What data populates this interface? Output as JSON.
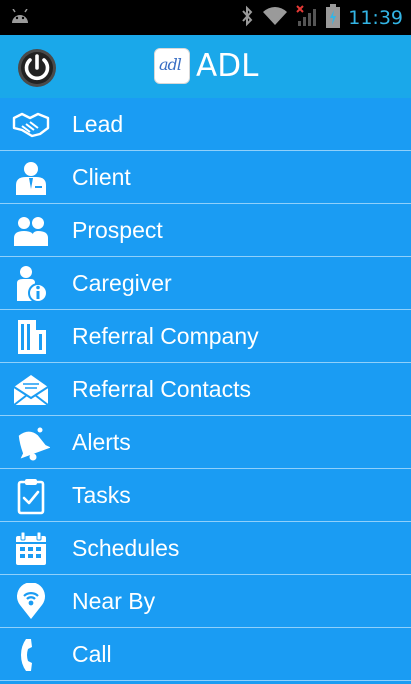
{
  "statusbar": {
    "time": "11:39",
    "icons": [
      "android-icon",
      "bluetooth-icon",
      "wifi-icon",
      "signal-icon",
      "battery-charging-icon"
    ]
  },
  "actionbar": {
    "logo_text": "adl",
    "title": "ADL",
    "color": "#1aa8ea"
  },
  "menu": {
    "color": "#1a9cf3",
    "items": [
      {
        "label": "Lead",
        "icon": "handshake-icon"
      },
      {
        "label": "Client",
        "icon": "client-icon"
      },
      {
        "label": "Prospect",
        "icon": "people-icon"
      },
      {
        "label": "Caregiver",
        "icon": "caregiver-info-icon"
      },
      {
        "label": "Referral Company",
        "icon": "building-icon"
      },
      {
        "label": "Referral Contacts",
        "icon": "envelope-icon"
      },
      {
        "label": "Alerts",
        "icon": "bell-icon"
      },
      {
        "label": "Tasks",
        "icon": "clipboard-check-icon"
      },
      {
        "label": "Schedules",
        "icon": "calendar-icon"
      },
      {
        "label": "Near By",
        "icon": "location-pin-icon"
      },
      {
        "label": "Call",
        "icon": "phone-icon"
      }
    ]
  }
}
